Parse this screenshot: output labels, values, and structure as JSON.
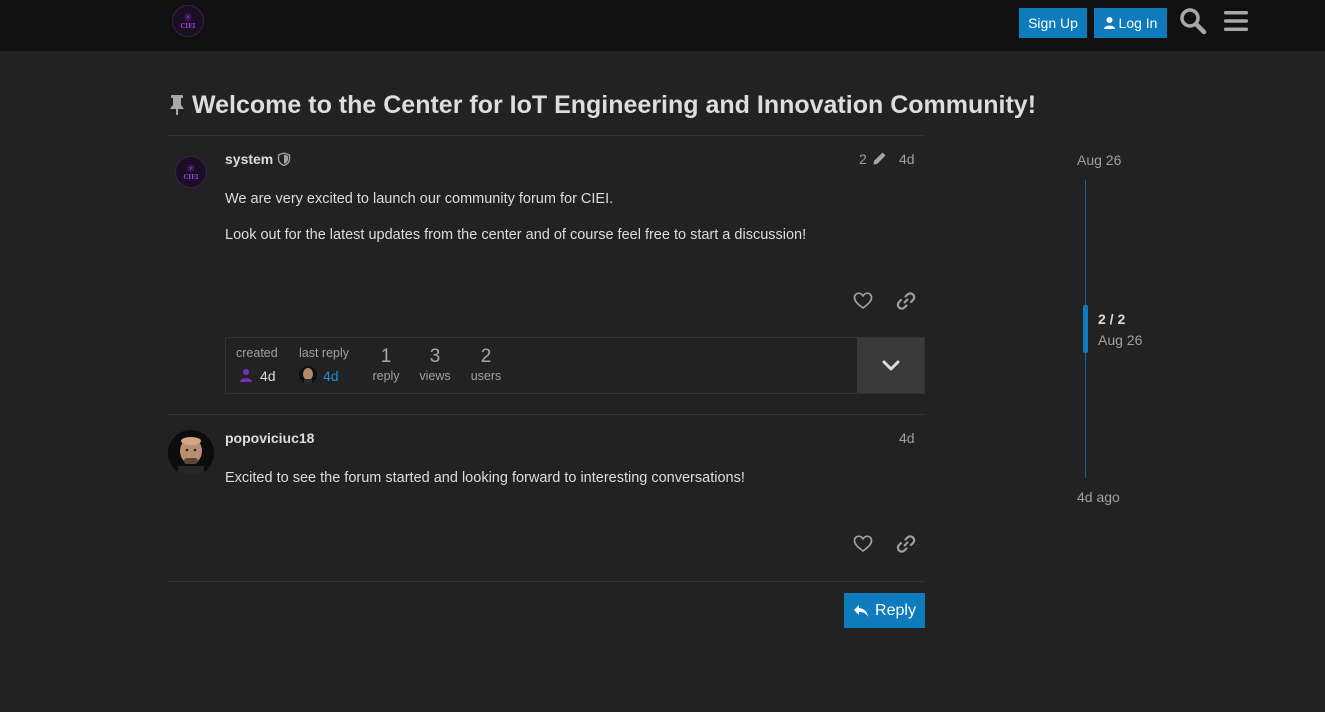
{
  "header": {
    "logo_text": "CIEI",
    "signup_label": "Sign Up",
    "login_label": "Log In",
    "accent_color": "#0e7bbd",
    "icons": [
      "search-icon",
      "hamburger-menu-icon",
      "user-icon"
    ]
  },
  "topic": {
    "title": "Welcome to the Center for IoT Engineering and Innovation Community!",
    "pinned": true
  },
  "posts": [
    {
      "username": "system",
      "edit_count": "2",
      "age": "4d",
      "paragraphs": [
        "We are very excited to launch our community forum for CIEI.",
        "Look out for the latest updates from the center and of course feel free to start a discussion!"
      ]
    },
    {
      "username": "popoviciuc18",
      "age": "4d",
      "paragraphs": [
        "Excited to see the forum started and looking forward to interesting conversations!"
      ]
    }
  ],
  "topic_map": {
    "created_label": "created",
    "created_age": "4d",
    "last_reply_label": "last reply",
    "last_reply_age": "4d",
    "replies_count": "1",
    "replies_label": "reply",
    "views_count": "3",
    "views_label": "views",
    "users_count": "2",
    "users_label": "users"
  },
  "reply_button_label": "Reply",
  "timeline": {
    "start_date": "Aug 26",
    "position": "2 / 2",
    "position_date": "Aug 26",
    "end_label": "4d ago"
  }
}
